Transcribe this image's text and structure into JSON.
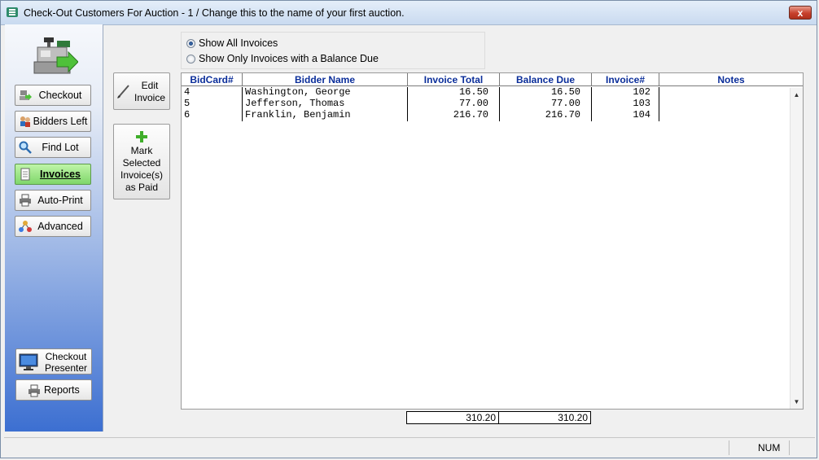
{
  "window": {
    "title": "Check-Out Customers For Auction  - 1 / Change this to the name of your first auction.",
    "close_label": "x"
  },
  "sidebar": {
    "items": [
      {
        "label": "Checkout",
        "icon": "checkout-icon"
      },
      {
        "label": "Bidders Left",
        "icon": "people-icon"
      },
      {
        "label": "Find Lot",
        "icon": "magnifier-icon"
      },
      {
        "label": "Invoices",
        "icon": "document-icon",
        "active": true
      },
      {
        "label": "Auto-Print",
        "icon": "printer-icon"
      },
      {
        "label": "Advanced",
        "icon": "network-icon"
      }
    ],
    "presenter_label_1": "Checkout",
    "presenter_label_2": "Presenter",
    "reports_label": "Reports"
  },
  "actions": {
    "edit_line1": "Edit",
    "edit_line2": "Invoice",
    "mark_lines": [
      "Mark",
      "Selected",
      "Invoice(s)",
      "as Paid"
    ]
  },
  "filter": {
    "options": [
      {
        "label": "Show All Invoices",
        "selected": true
      },
      {
        "label": "Show Only Invoices with a Balance Due",
        "selected": false
      }
    ]
  },
  "grid": {
    "columns": [
      "BidCard#",
      "Bidder Name",
      "Invoice Total",
      "Balance Due",
      "Invoice#",
      "Notes"
    ],
    "rows": [
      {
        "bidcard": "4",
        "name": "Washington, George",
        "total": "16.50",
        "balance": "16.50",
        "invoice": "102",
        "notes": ""
      },
      {
        "bidcard": "5",
        "name": "Jefferson, Thomas",
        "total": "77.00",
        "balance": "77.00",
        "invoice": "103",
        "notes": ""
      },
      {
        "bidcard": "6",
        "name": "Franklin, Benjamin",
        "total": "216.70",
        "balance": "216.70",
        "invoice": "104",
        "notes": ""
      }
    ]
  },
  "totals": {
    "invoice_total": "310.20",
    "balance_due": "310.20"
  },
  "status": {
    "num": "NUM"
  },
  "colors": {
    "header_text": "#0b2e9a",
    "active_button": "#7fd66a",
    "sidebar_bottom": "#3c6fd1"
  }
}
